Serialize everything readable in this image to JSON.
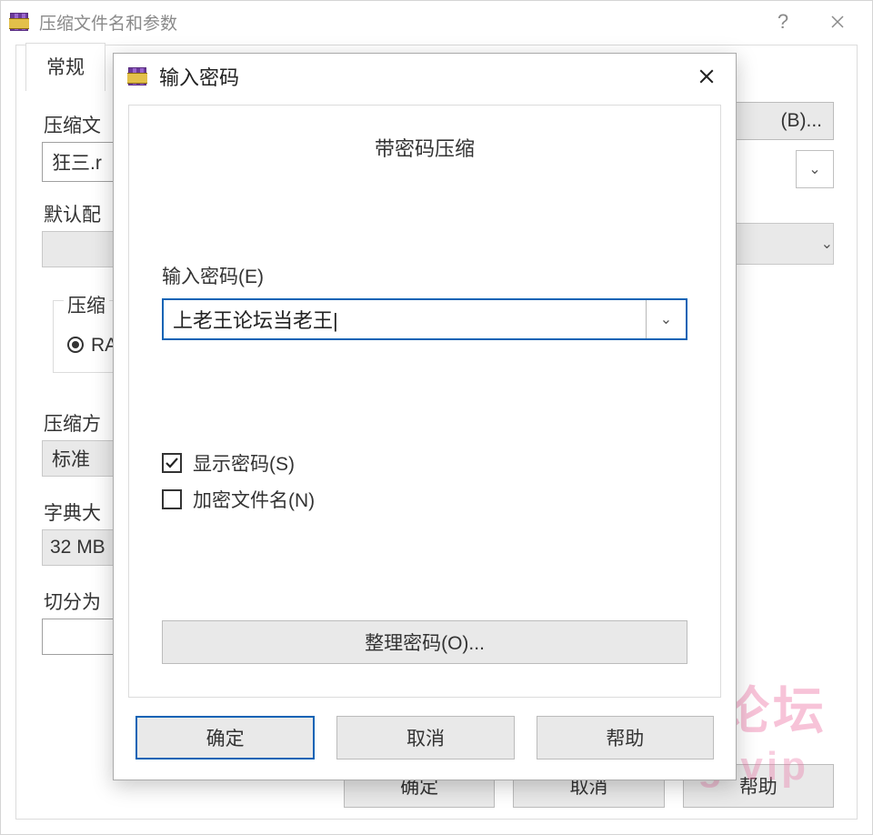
{
  "main": {
    "title": "压缩文件名和参数",
    "tab_general": "常规",
    "label_filename": "压缩文",
    "filename_value": "狂三.r",
    "label_default_profile": "默认配",
    "group_format_label": "压缩",
    "radio_rar": "RA",
    "label_method": "压缩方",
    "method_value": "标准",
    "label_dict": "字典大",
    "dict_value": "32 MB",
    "label_split": "切分为",
    "browse_fragment": "(B)...",
    "btn_ok": "确定",
    "btn_cancel": "取消",
    "btn_help": "帮助"
  },
  "modal": {
    "title": "输入密码",
    "heading": "带密码压缩",
    "label_password": "输入密码(E)",
    "password_value": "上老王论坛当老王|",
    "check_show": "显示密码(S)",
    "check_show_checked": true,
    "check_encrypt_names": "加密文件名(N)",
    "check_encrypt_checked": false,
    "organize": "整理密码(O)...",
    "btn_ok": "确定",
    "btn_cancel": "取消",
    "btn_help": "帮助"
  },
  "watermark": {
    "line1": "老王论坛",
    "line2": "laowang.vip"
  }
}
